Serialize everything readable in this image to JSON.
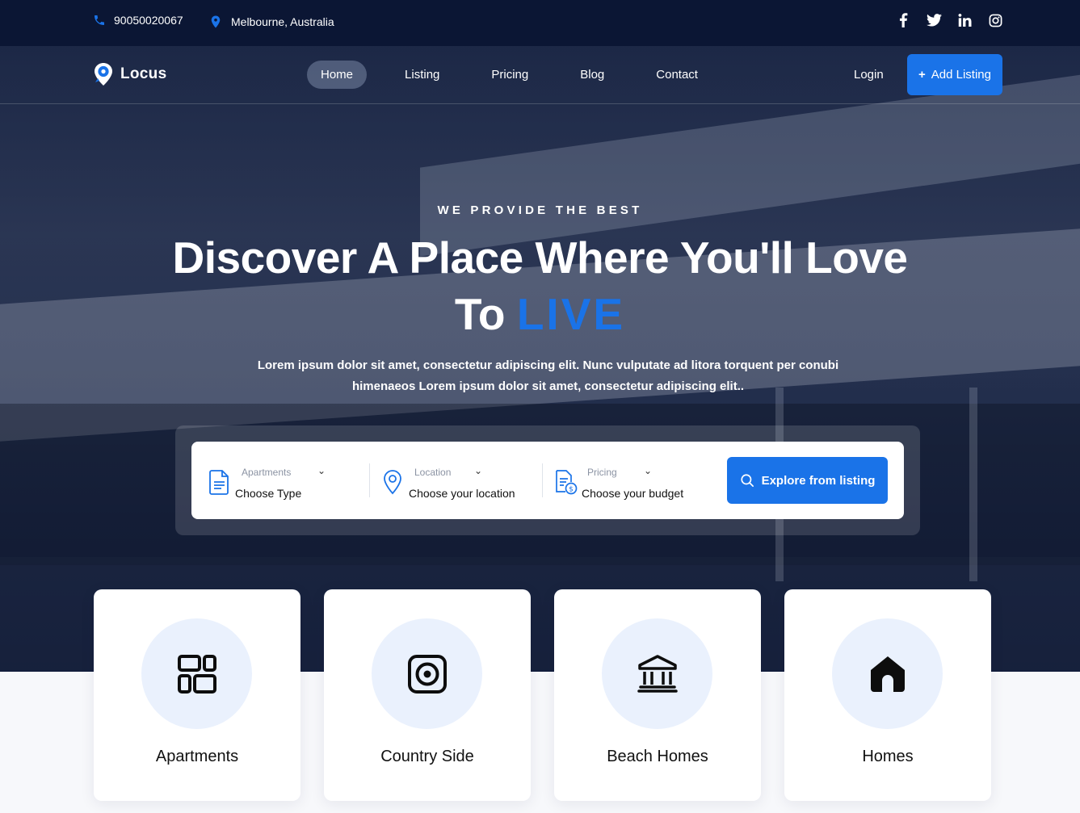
{
  "topbar": {
    "phone": "90050020067",
    "location": "Melbourne, Australia",
    "social": [
      "facebook-icon",
      "twitter-icon",
      "linkedin-icon",
      "instagram-icon"
    ]
  },
  "nav": {
    "brand": "Locus",
    "items": [
      {
        "label": "Home",
        "active": true
      },
      {
        "label": "Listing",
        "active": false
      },
      {
        "label": "Pricing",
        "active": false
      },
      {
        "label": "Blog",
        "active": false
      },
      {
        "label": "Contact",
        "active": false
      }
    ],
    "login": "Login",
    "add_listing": "Add Listing",
    "add_symbol": "+"
  },
  "hero": {
    "eyebrow": "WE PROVIDE THE BEST",
    "headline_line1": "Discover A Place Where You'll Love",
    "headline_to": "To",
    "headline_accent": "LIVE",
    "lead": "Lorem ipsum dolor sit amet, consectetur adipiscing elit. Nunc vulputate ad litora torquent per conubi himenaeos Lorem ipsum dolor sit amet, consectetur adipiscing elit.."
  },
  "search": {
    "type": {
      "label": "Apartments",
      "value": "Choose Type"
    },
    "location": {
      "label": "Location",
      "value": "Choose your location"
    },
    "pricing": {
      "label": "Pricing",
      "value": "Choose your budget"
    },
    "button": "Explore from listing"
  },
  "categories": [
    {
      "name": "Apartments",
      "icon": "grid-layout-icon"
    },
    {
      "name": "Country Side",
      "icon": "target-square-icon"
    },
    {
      "name": "Beach Homes",
      "icon": "bank-building-icon"
    },
    {
      "name": "Homes",
      "icon": "home-icon"
    }
  ],
  "colors": {
    "accent": "#1a73e8",
    "topbar": "#0b1634",
    "icon_circle": "#eaf1fd"
  }
}
